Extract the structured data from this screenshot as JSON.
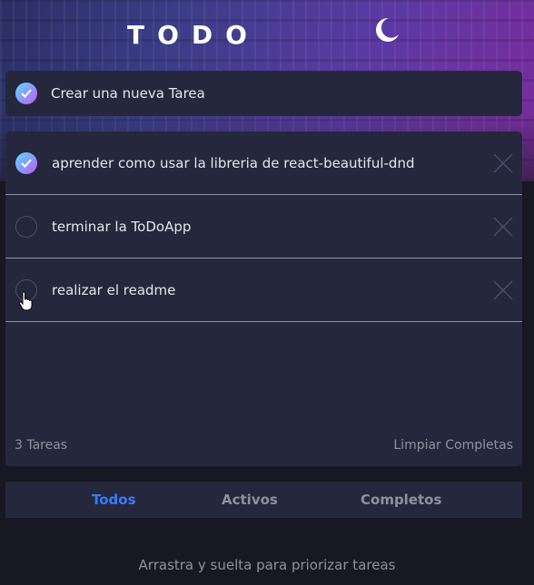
{
  "header": {
    "title": "TODO",
    "theme_icon": "moon-icon"
  },
  "new_task": {
    "label": "Crear una nueva Tarea",
    "checked": true
  },
  "tasks": [
    {
      "text": "aprender como usar la libreria de react-beautiful-dnd",
      "completed": true
    },
    {
      "text": "terminar la ToDoApp",
      "completed": false
    },
    {
      "text": "realizar el readme",
      "completed": false
    }
  ],
  "footer": {
    "count": "3 Tareas",
    "clear": "Limpiar Completas"
  },
  "filters": {
    "all": "Todos",
    "active": "Activos",
    "completed": "Completos",
    "selected": "Todos"
  },
  "hint": "Arrastra y suelta para priorizar tareas",
  "colors": {
    "accent": "#3a7bfd",
    "check_from": "#57ddff",
    "check_to": "#c058f3",
    "panel": "#25273c",
    "background": "#181824"
  }
}
